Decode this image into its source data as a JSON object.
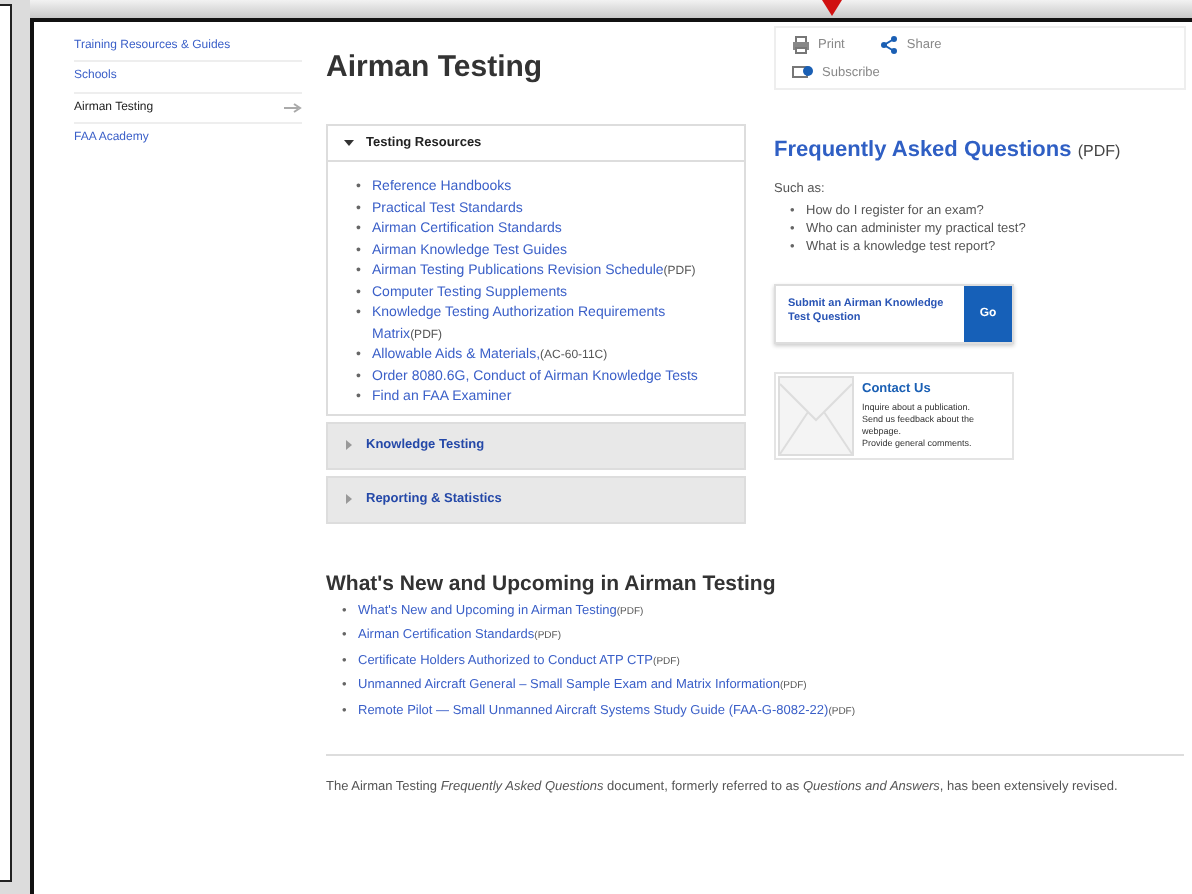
{
  "sidebar": {
    "items": [
      {
        "label": "Training Resources & Guides",
        "selected": false
      },
      {
        "label": "Schools",
        "selected": false
      },
      {
        "label": "Airman Testing",
        "selected": true
      },
      {
        "label": "FAA Academy",
        "selected": false
      }
    ]
  },
  "page_title": "Airman Testing",
  "share_box": {
    "print": "Print",
    "share": "Share",
    "subscribe": "Subscribe"
  },
  "accordion": [
    {
      "title": "Testing Resources",
      "expanded": true,
      "bullet": "•",
      "items": [
        {
          "text": "Reference Handbooks"
        },
        {
          "text": "Practical Test Standards"
        },
        {
          "text": "Airman Certification Standards"
        },
        {
          "text": "Airman Knowledge Test Guides"
        },
        {
          "text": "Airman Testing Publications Revision Schedule",
          "note": "(PDF)"
        },
        {
          "text": "Computer Testing Supplements"
        },
        {
          "text": "Knowledge Testing Authorization Requirements Matrix",
          "note": "(PDF)"
        },
        {
          "text": "Allowable Aids & Materials,",
          "note": "(AC-60-11C)"
        },
        {
          "text": "Order 8080.6G, Conduct of Airman Knowledge Tests"
        },
        {
          "text": "Find an FAA Examiner"
        }
      ]
    },
    {
      "title": "Knowledge Testing",
      "expanded": false
    },
    {
      "title": "Reporting & Statistics",
      "expanded": false
    }
  ],
  "faq": {
    "title": "Frequently Asked Questions",
    "note": "(PDF)",
    "intro": "Such as:",
    "bullet": "•",
    "questions": [
      "How do I register for an exam?",
      "Who can administer my practical test?",
      "What is a knowledge test report?"
    ]
  },
  "submit_button": {
    "label": "Submit an Airman Knowledge Test Question",
    "go": "Go"
  },
  "contact_card": {
    "title": "Contact Us",
    "lines": [
      "Inquire about a publication.",
      "Send us feedback about the webpage.",
      "Provide general comments."
    ]
  },
  "whats_new": {
    "title": "What's New and Upcoming in Airman Testing",
    "bullet": "•",
    "items": [
      {
        "text": "What's New and Upcoming in Airman Testing",
        "note": "(PDF)"
      },
      {
        "text": "Airman Certification Standards",
        "note": "(PDF)"
      },
      {
        "text": "Certificate Holders Authorized to Conduct ATP CTP",
        "note": "(PDF)"
      },
      {
        "text": "Unmanned Aircraft General – Small Sample Exam and Matrix Information",
        "note": "(PDF)"
      },
      {
        "text": "Remote Pilot — Small Unmanned Aircraft Systems Study Guide (FAA-G-8082-22)",
        "note": "(PDF)"
      }
    ]
  },
  "footer_text": "The Airman Testing *Frequently Asked Questions* document, formerly referred to as *Questions and Answers*, has been extensively revised."
}
